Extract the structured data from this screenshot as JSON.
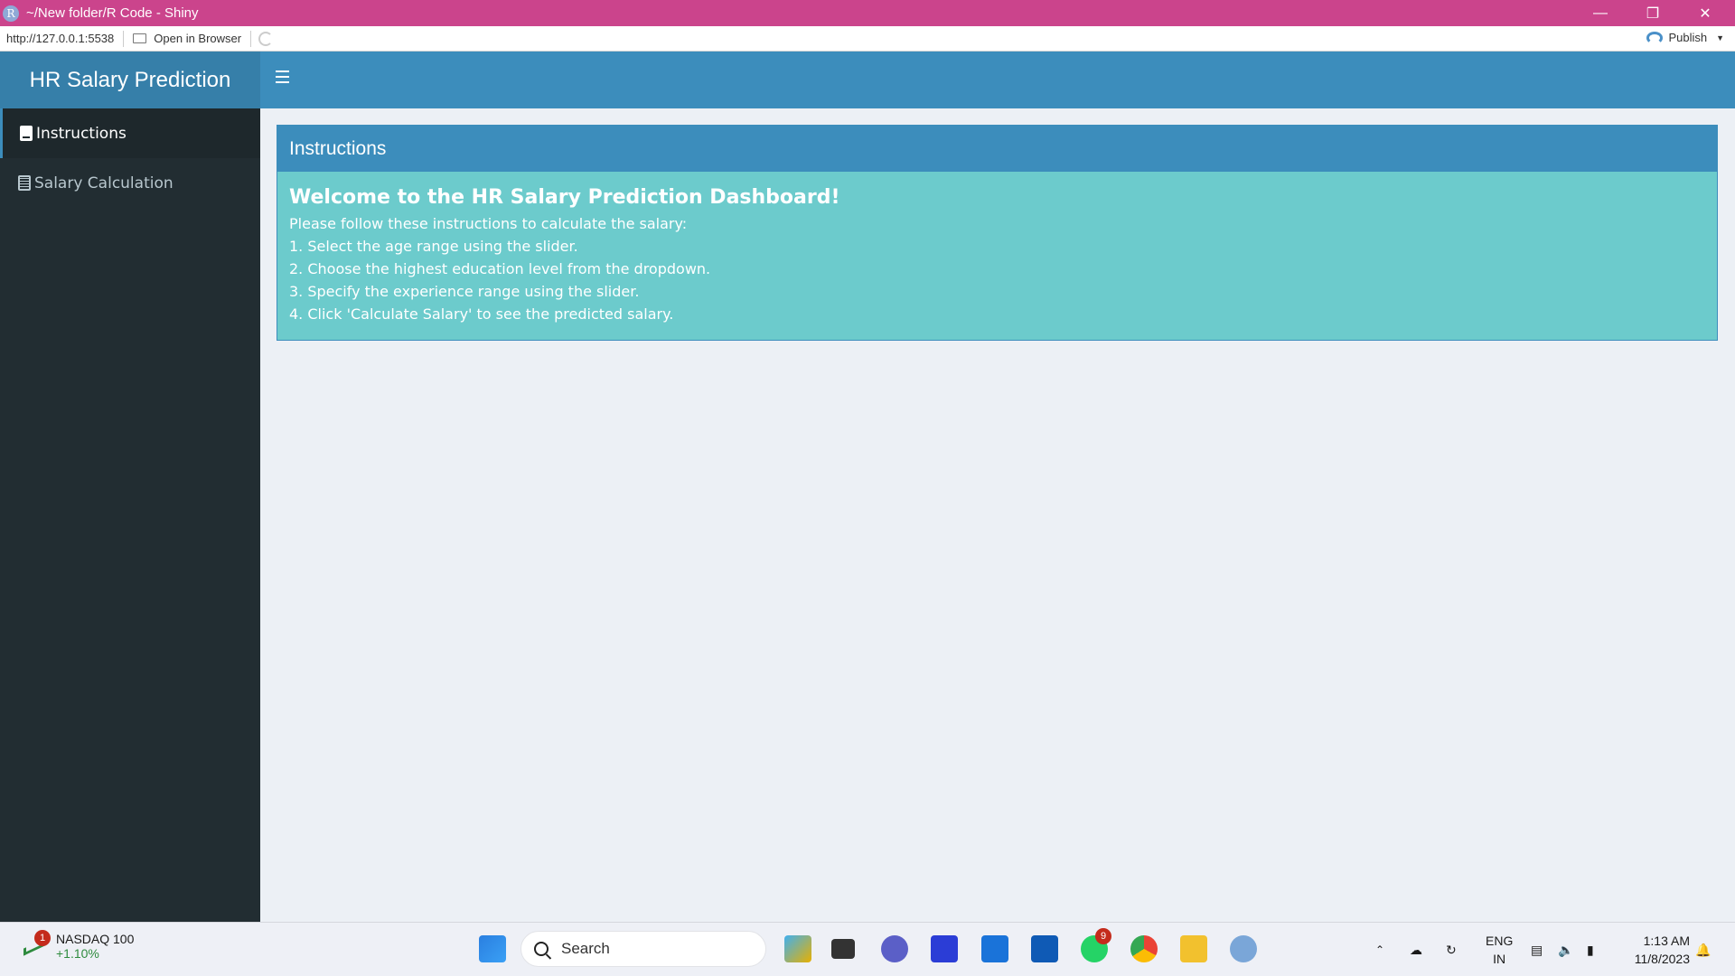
{
  "window": {
    "title": "~/New folder/R Code - Shiny",
    "logo_letter": "R"
  },
  "viewer": {
    "url": "http://127.0.0.1:5538",
    "open_in_browser": "Open in Browser",
    "publish": "Publish"
  },
  "header": {
    "app_title": "HR Salary Prediction"
  },
  "sidebar": {
    "items": [
      {
        "label": "Instructions",
        "icon": "book-icon",
        "active": true
      },
      {
        "label": "Salary Calculation",
        "icon": "calculator-icon",
        "active": false
      }
    ]
  },
  "main": {
    "box_title": "Instructions",
    "heading": "Welcome to the HR Salary Prediction Dashboard!",
    "intro": "Please follow these instructions to calculate the salary:",
    "steps": [
      "1. Select the age range using the slider.",
      "2. Choose the highest education level from the dropdown.",
      "3. Specify the experience range using the slider.",
      "4. Click 'Calculate Salary' to see the predicted salary."
    ]
  },
  "taskbar": {
    "stock_name": "NASDAQ 100",
    "stock_change": "+1.10%",
    "stock_badge": "1",
    "search_placeholder": "Search",
    "whatsapp_badge": "9",
    "lang_line1": "ENG",
    "lang_line2": "IN",
    "time": "1:13 AM",
    "date": "11/8/2023"
  },
  "colors": {
    "titlebar": "#cb448c",
    "logo_bg": "#367fa9",
    "navbar_bg": "#3c8dbc",
    "sidebar_bg": "#222d32",
    "box_body": "#6ccbcc"
  }
}
